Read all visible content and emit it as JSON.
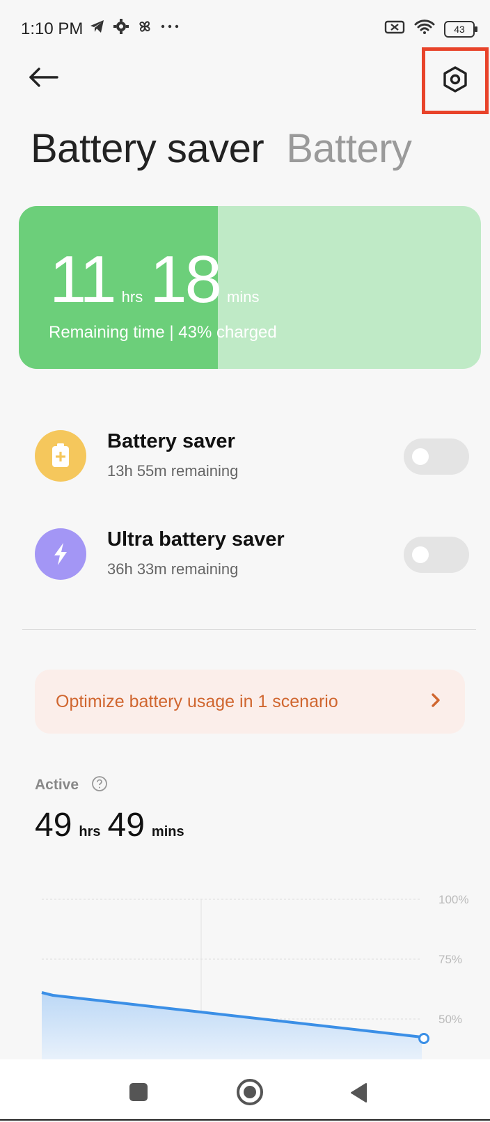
{
  "status_bar": {
    "time": "1:10 PM",
    "battery_level": "43",
    "icons": [
      "telegram-icon",
      "gear-icon",
      "pinwheel-icon",
      "more-icon",
      "sim-off-icon",
      "wifi-icon",
      "battery-icon"
    ]
  },
  "header": {
    "title_active": "Battery saver",
    "title_inactive": "Battery",
    "back_icon": "arrow-left-icon",
    "settings_icon": "gear-hexagon-icon",
    "highlight_color": "#e8432a"
  },
  "battery_card": {
    "hours": "11",
    "hours_unit": "hrs",
    "minutes": "18",
    "minutes_unit": "mins",
    "caption": "Remaining time | 43% charged",
    "charge_percent": 43,
    "fill_color": "#6ccf7a",
    "track_color": "#bfeac6"
  },
  "savers": [
    {
      "title": "Battery saver",
      "subtitle": "13h 55m remaining",
      "icon": "battery-plus-icon",
      "icon_color": "#f5c75c",
      "enabled": false
    },
    {
      "title": "Ultra battery saver",
      "subtitle": "36h 33m remaining",
      "icon": "lightning-icon",
      "icon_color": "#a396f5",
      "enabled": false
    }
  ],
  "optimize": {
    "label": "Optimize battery usage in 1 scenario",
    "color": "#d0662f"
  },
  "active": {
    "label": "Active",
    "hours": "49",
    "hours_unit": "hrs",
    "minutes": "49",
    "minutes_unit": "mins"
  },
  "chart": {
    "y_ticks": [
      "100%",
      "75%",
      "50%"
    ],
    "line_color": "#3b8fe6"
  },
  "nav": {
    "icons": [
      "recents-icon",
      "home-icon",
      "back-triangle-icon"
    ]
  }
}
